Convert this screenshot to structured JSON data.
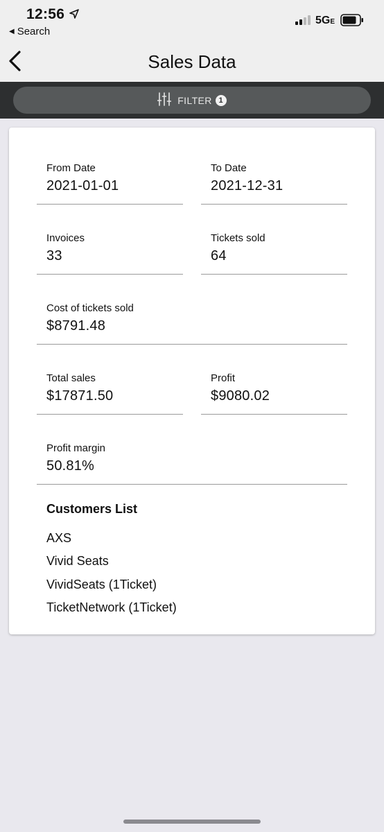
{
  "status_bar": {
    "time": "12:56",
    "back_app": "Search",
    "network": "5G",
    "network_suffix": "E",
    "icons": [
      "location-arrow-icon",
      "signal-bars-icon",
      "battery-icon"
    ]
  },
  "nav": {
    "title": "Sales Data",
    "back_icon": "chevron-left-icon"
  },
  "filter": {
    "label": "FILTER",
    "badge": "1",
    "icon": "sliders-icon"
  },
  "fields": {
    "from_date": {
      "label": "From Date",
      "value": "2021-01-01"
    },
    "to_date": {
      "label": "To Date",
      "value": "2021-12-31"
    },
    "invoices": {
      "label": "Invoices",
      "value": "33"
    },
    "tickets_sold": {
      "label": "Tickets sold",
      "value": "64"
    },
    "cost_of_tickets": {
      "label": "Cost of tickets sold",
      "value": "$8791.48"
    },
    "total_sales": {
      "label": "Total sales",
      "value": "$17871.50"
    },
    "profit": {
      "label": "Profit",
      "value": "$9080.02"
    },
    "profit_margin": {
      "label": "Profit margin",
      "value": "50.81%"
    }
  },
  "customers": {
    "title": "Customers List",
    "items": [
      "AXS",
      "Vivid Seats",
      "VividSeats (1Ticket)",
      "TicketNetwork (1Ticket)"
    ]
  },
  "colors": {
    "page_bg": "#e9e8ee",
    "header_bg": "#efefef",
    "filter_bar_bg": "#2d2f30",
    "filter_button_bg": "#56595a",
    "card_bg": "#ffffff"
  }
}
